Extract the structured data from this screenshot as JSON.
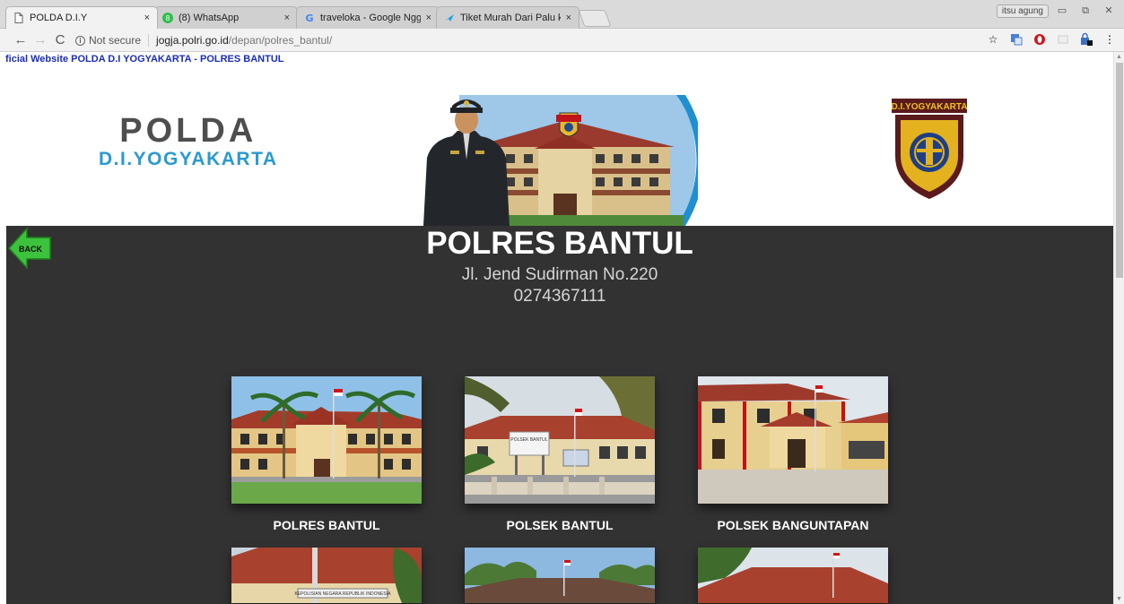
{
  "browser": {
    "tabs": [
      {
        "label": "POLDA D.I.Y",
        "icon": "page-icon"
      },
      {
        "label": "(8) WhatsApp",
        "icon": "whatsapp-icon"
      },
      {
        "label": "traveloka - Google Nggo",
        "icon": "google-icon"
      },
      {
        "label": "Tiket Murah Dari Palu ke",
        "icon": "traveloka-icon"
      }
    ],
    "tab_close": "×",
    "user_name": "itsu agung",
    "security_label": "Not secure",
    "url_host": "jogja.polri.go.id",
    "url_path": "/depan/polres_bantul/"
  },
  "page": {
    "marquee": "ficial Website POLDA D.I YOGYAKARTA - POLRES BANTUL",
    "logo_top": "POLDA",
    "logo_sub": "D.I.YOGYAKARTA",
    "badge_text": "D.I.YOGYAKARTA",
    "back_label": "BACK",
    "title": "POLRES BANTUL",
    "address": "Jl. Jend Sudirman No.220",
    "phone": "0274367111",
    "cards": [
      {
        "name": "POLRES BANTUL"
      },
      {
        "name": "POLSEK BANTUL"
      },
      {
        "name": "POLSEK BANGUNTAPAN"
      }
    ],
    "sign_polsek": "POLSEK BANTUL",
    "sign_kepolisian": "KEPOLISIAN NEGARA REPUBLIK INDONESIA"
  },
  "colors": {
    "dark_bg": "#323232",
    "logo_blue": "#2a9ad0",
    "marquee_blue": "#1a2db8",
    "back_green": "#3cc23c"
  }
}
